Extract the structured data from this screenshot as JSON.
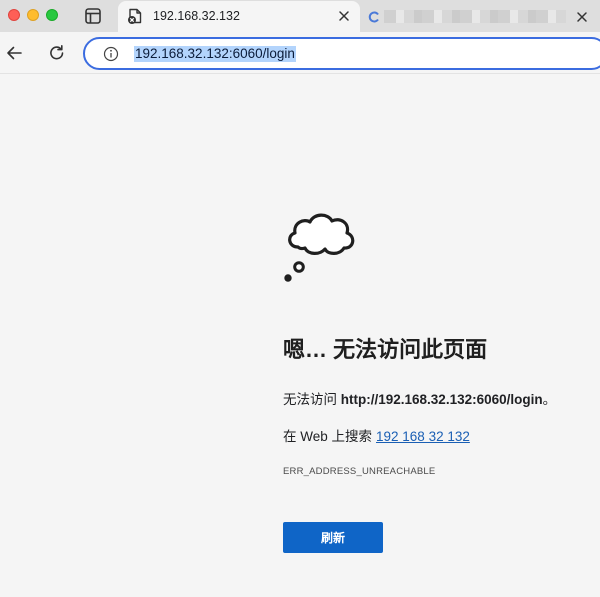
{
  "browser": {
    "active_tab": {
      "title": "192.168.32.132"
    },
    "inactive_tab": {
      "title_obscured": true
    },
    "address_bar": {
      "url": "192.168.32.132:6060/login"
    },
    "accent_color": "#3b6ce0"
  },
  "error_page": {
    "heading": "嗯… 无法访问此页面",
    "line1_prefix": "无法访问 ",
    "line1_url": "http://192.168.32.132:6060/login",
    "line1_suffix": "。",
    "line2_prefix": "在 Web 上搜索",
    "line2_search_link": "192 168 32 132",
    "error_code": "ERR_ADDRESS_UNREACHABLE",
    "refresh_label": "刷新",
    "button_color": "#0f65c7"
  }
}
